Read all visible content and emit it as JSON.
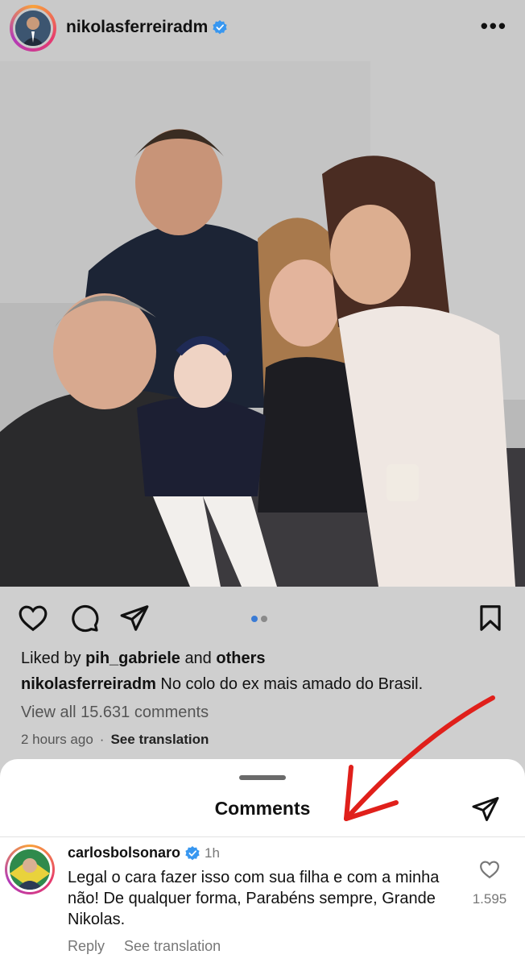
{
  "post": {
    "username": "nikolasferreiradm",
    "more_label": "•••",
    "liked_prefix": "Liked by",
    "liked_user": "pih_gabriele",
    "liked_and": "and",
    "liked_others": "others",
    "caption_user": "nikolasferreiradm",
    "caption_text": "No colo do ex mais amado do Brasil.",
    "view_all": "View all 15.631 comments",
    "time": "2 hours ago",
    "see_translation": "See translation"
  },
  "carousel": {
    "count": 2,
    "active": 1
  },
  "comments_sheet": {
    "title": "Comments",
    "comment": {
      "username": "carlosbolsonaro",
      "time": "1h",
      "text": "Legal o cara fazer isso com sua filha e com a minha não! De qualquer forma, Parabéns sempre, Grande Nikolas.",
      "likes": "1.595",
      "reply_label": "Reply",
      "see_translation": "See translation"
    }
  },
  "colors": {
    "verified": "#3897f0",
    "annotation_arrow": "#e0201b",
    "carousel_active": "#3a7bd5"
  },
  "icons": [
    "heart-icon",
    "comment-icon",
    "share-icon",
    "bookmark-icon",
    "send-icon",
    "verified-icon",
    "more-icon"
  ]
}
